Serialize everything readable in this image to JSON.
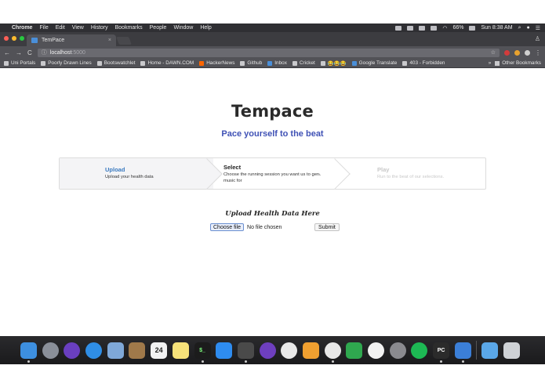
{
  "menubar": {
    "apple": "",
    "items": [
      "Chrome",
      "File",
      "Edit",
      "View",
      "History",
      "Bookmarks",
      "People",
      "Window",
      "Help"
    ],
    "battery": "66%",
    "clock": "Sun 8:38 AM"
  },
  "tab": {
    "title": "TemPace",
    "close": "×"
  },
  "address": {
    "back": "←",
    "forward": "→",
    "reload": "C",
    "host": "localhost",
    "port": ":5000",
    "star": "☆"
  },
  "bookmarks": {
    "items": [
      "Uni Portals",
      "Poorly Drawn Lines",
      "Bootswatchlet",
      "Home - DAWN.COM",
      "HackerNews",
      "Github",
      "Inbox",
      "Cricket",
      "😂😂😂",
      "Google Translate",
      "403 - Forbidden"
    ],
    "other": "Other Bookmarks",
    "more": "»"
  },
  "page": {
    "title": "Tempace",
    "subtitle": "Pace yourself to the beat",
    "steps": [
      {
        "title": "Upload",
        "desc": "Upload your health data"
      },
      {
        "title": "Select",
        "desc": "Choose the running session you want us to generate music for"
      },
      {
        "title": "Play",
        "desc": "Run to the beat of our selections."
      }
    ],
    "upload_heading": "Upload Health Data Here",
    "choose_file": "Choose file",
    "no_file": "No file chosen",
    "submit": "Submit"
  },
  "dock": {
    "apps": [
      {
        "name": "finder-icon",
        "color": "#3d8fe0"
      },
      {
        "name": "launchpad-icon",
        "color": "#8a8f99"
      },
      {
        "name": "siri-icon",
        "color": "#6a3fc0"
      },
      {
        "name": "safari-icon",
        "color": "#2f8ee6"
      },
      {
        "name": "mail-icon",
        "color": "#7fa8d8"
      },
      {
        "name": "contacts-icon",
        "color": "#a0794a"
      },
      {
        "name": "calendar-icon",
        "color": "#f2f2f2"
      },
      {
        "name": "notes-icon",
        "color": "#f7e27a"
      },
      {
        "name": "terminal-icon",
        "color": "#1c1c1c"
      },
      {
        "name": "messages-icon",
        "color": "#2e8cf0"
      },
      {
        "name": "sublime-icon",
        "color": "#4a4a4a"
      },
      {
        "name": "github-icon",
        "color": "#6e3fbf"
      },
      {
        "name": "photos-icon",
        "color": "#e9e9e9"
      },
      {
        "name": "pages-icon",
        "color": "#f0a030"
      },
      {
        "name": "chrome-icon",
        "color": "#e8e8e8"
      },
      {
        "name": "numbers-icon",
        "color": "#2fa84f"
      },
      {
        "name": "itunes-icon",
        "color": "#f2f2f2"
      },
      {
        "name": "system-preferences-icon",
        "color": "#8a8a8f"
      },
      {
        "name": "spotify-icon",
        "color": "#1db954"
      },
      {
        "name": "pycharm-icon",
        "color": "#2b2b2b"
      },
      {
        "name": "xcode-icon",
        "color": "#3b7fd8"
      }
    ],
    "calendar_day": "24",
    "terminal_label": "$_",
    "pycharm_label": "PC",
    "folder": {
      "name": "downloads-folder-icon",
      "color": "#5aa7e8"
    },
    "trash": {
      "name": "trash-icon",
      "color": "#cfd2d6"
    }
  }
}
